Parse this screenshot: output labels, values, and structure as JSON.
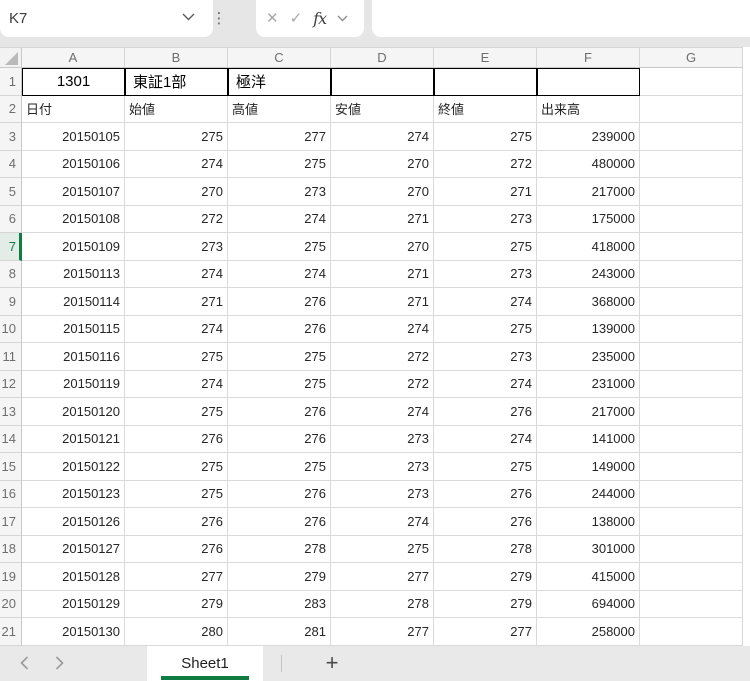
{
  "name_box": {
    "value": "K7"
  },
  "formula_bar": {
    "value": ""
  },
  "icons": {
    "cancel": "✕",
    "enter": "✓",
    "insert_function": "fx",
    "more": "⋮",
    "name_box_dropdown": "chevron-down",
    "function_dropdown": "chevron-down",
    "prev_sheet": "chevron-left",
    "next_sheet": "chevron-right",
    "select_all": "corner-triangle"
  },
  "selection": {
    "active_cell": "K7",
    "highlighted_row": 7
  },
  "grid": {
    "columns": [
      "A",
      "B",
      "C",
      "D",
      "E",
      "F",
      "G"
    ],
    "rows": [
      {
        "n": 1,
        "cells": [
          "1301",
          "東証1部",
          "極洋",
          "",
          "",
          "",
          ""
        ]
      },
      {
        "n": 2,
        "cells": [
          "日付",
          "始値",
          "高値",
          "安値",
          "終値",
          "出来高",
          ""
        ]
      },
      {
        "n": 3,
        "cells": [
          "20150105",
          "275",
          "277",
          "274",
          "275",
          "239000",
          ""
        ]
      },
      {
        "n": 4,
        "cells": [
          "20150106",
          "274",
          "275",
          "270",
          "272",
          "480000",
          ""
        ]
      },
      {
        "n": 5,
        "cells": [
          "20150107",
          "270",
          "273",
          "270",
          "271",
          "217000",
          ""
        ]
      },
      {
        "n": 6,
        "cells": [
          "20150108",
          "272",
          "274",
          "271",
          "273",
          "175000",
          ""
        ]
      },
      {
        "n": 7,
        "cells": [
          "20150109",
          "273",
          "275",
          "270",
          "275",
          "418000",
          ""
        ]
      },
      {
        "n": 8,
        "cells": [
          "20150113",
          "274",
          "274",
          "271",
          "273",
          "243000",
          ""
        ]
      },
      {
        "n": 9,
        "cells": [
          "20150114",
          "271",
          "276",
          "271",
          "274",
          "368000",
          ""
        ]
      },
      {
        "n": 10,
        "cells": [
          "20150115",
          "274",
          "276",
          "274",
          "275",
          "139000",
          ""
        ]
      },
      {
        "n": 11,
        "cells": [
          "20150116",
          "275",
          "275",
          "272",
          "273",
          "235000",
          ""
        ]
      },
      {
        "n": 12,
        "cells": [
          "20150119",
          "274",
          "275",
          "272",
          "274",
          "231000",
          ""
        ]
      },
      {
        "n": 13,
        "cells": [
          "20150120",
          "275",
          "276",
          "274",
          "276",
          "217000",
          ""
        ]
      },
      {
        "n": 14,
        "cells": [
          "20150121",
          "276",
          "276",
          "273",
          "274",
          "141000",
          ""
        ]
      },
      {
        "n": 15,
        "cells": [
          "20150122",
          "275",
          "275",
          "273",
          "275",
          "149000",
          ""
        ]
      },
      {
        "n": 16,
        "cells": [
          "20150123",
          "275",
          "276",
          "273",
          "276",
          "244000",
          ""
        ]
      },
      {
        "n": 17,
        "cells": [
          "20150126",
          "276",
          "276",
          "274",
          "276",
          "138000",
          ""
        ]
      },
      {
        "n": 18,
        "cells": [
          "20150127",
          "276",
          "278",
          "275",
          "278",
          "301000",
          ""
        ]
      },
      {
        "n": 19,
        "cells": [
          "20150128",
          "277",
          "279",
          "277",
          "279",
          "415000",
          ""
        ]
      },
      {
        "n": 20,
        "cells": [
          "20150129",
          "279",
          "283",
          "278",
          "279",
          "694000",
          ""
        ]
      },
      {
        "n": 21,
        "cells": [
          "20150130",
          "280",
          "281",
          "277",
          "277",
          "258000",
          ""
        ]
      }
    ]
  },
  "tabbar": {
    "tabs": [
      {
        "label": "Sheet1",
        "active": true
      }
    ],
    "add_label": "+"
  },
  "colors": {
    "accent_green": "#107c41",
    "selected_row_header_bg": "#e3ece6",
    "topbar_gray": "#e6e6e6",
    "header_gray": "#f5f5f5",
    "gridline": "#dadada",
    "range_border": "#000000"
  }
}
